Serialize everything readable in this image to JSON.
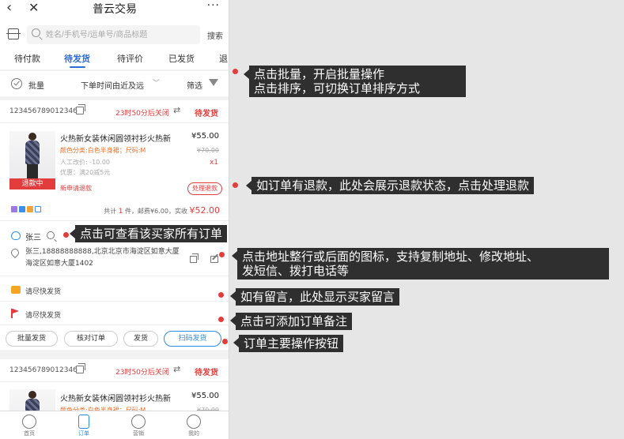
{
  "nav": {
    "back_icon": "chevron-left",
    "close_icon": "x",
    "title": "普云交易",
    "more": "···"
  },
  "search": {
    "placeholder": "姓名/手机号/运单号/商品标题",
    "button": "搜索"
  },
  "tabs": [
    {
      "label": "待付款",
      "active": false
    },
    {
      "label": "待发货",
      "active": true
    },
    {
      "label": "待评价",
      "active": false
    },
    {
      "label": "已发货",
      "active": false
    },
    {
      "label": "退",
      "active": false
    }
  ],
  "toolbar": {
    "batch": "批量",
    "sort": "下单时间由近及远",
    "filter": "筛选"
  },
  "order1": {
    "order_no": "123456789012346",
    "countdown": "23时50分后关闭",
    "status": "待发货",
    "refund_tag": "退款中",
    "product": {
      "title": "火热新女装休闲圆领衬衫火热新",
      "price": "¥55.00",
      "spec": "颜色分类:白色半身裙；尺码:M",
      "original_price": "¥70.00",
      "manual_adjust": "人工改价: -10.00",
      "qty": "x1",
      "discount": "优惠：满20减5元"
    },
    "refund_request": "新申请退款",
    "handle_refund": "处理退款",
    "total": {
      "prefix": "共计",
      "count": "1",
      "suffix": "件，邮费¥6.00，实收",
      "amount": "¥52.00"
    },
    "buyer": "张三",
    "address": "张三,18888888888,北京北京市海淀区如意大厦海淀区如意大厦1402",
    "message": "请尽快发货",
    "remark": "请尽快发货",
    "buttons": {
      "batch_ship": "批量发货",
      "verify": "核对订单",
      "ship": "发货",
      "scan_ship": "扫码发货"
    }
  },
  "order2": {
    "order_no": "123456789012346",
    "countdown": "23时50分后关闭",
    "status": "待发货",
    "product": {
      "title": "火热新女装休闲圆领衬衫火热新",
      "price": "¥55.00",
      "spec": "颜色分类:白色半身裙；尺码:M",
      "original_price": "¥70.00"
    }
  },
  "tabbar": [
    {
      "label": "首页",
      "icon": "home-icon"
    },
    {
      "label": "订单",
      "icon": "order-icon",
      "active": true
    },
    {
      "label": "营销",
      "icon": "marketing-icon"
    },
    {
      "label": "我的",
      "icon": "profile-icon"
    }
  ],
  "callouts": {
    "batch_sort_line1": "点击批量，开启批量操作",
    "batch_sort_line2": "点击排序，可切换订单排序方式",
    "refund": "如订单有退款，此处会展示退款状态，点击处理退款",
    "buyer_orders": "点击可查看该买家所有订单",
    "address_line1": "点击地址整行或后面的图标，支持复制地址、修改地址、",
    "address_line2": "发短信、拨打电话等",
    "message": "如有留言，此处显示买家留言",
    "remark": "点击可添加订单备注",
    "main_buttons": "订单主要操作按钮"
  },
  "colors": {
    "accent": "#2d6bd6",
    "danger": "#e23c3c",
    "callout_bg": "#2f2f2f"
  }
}
